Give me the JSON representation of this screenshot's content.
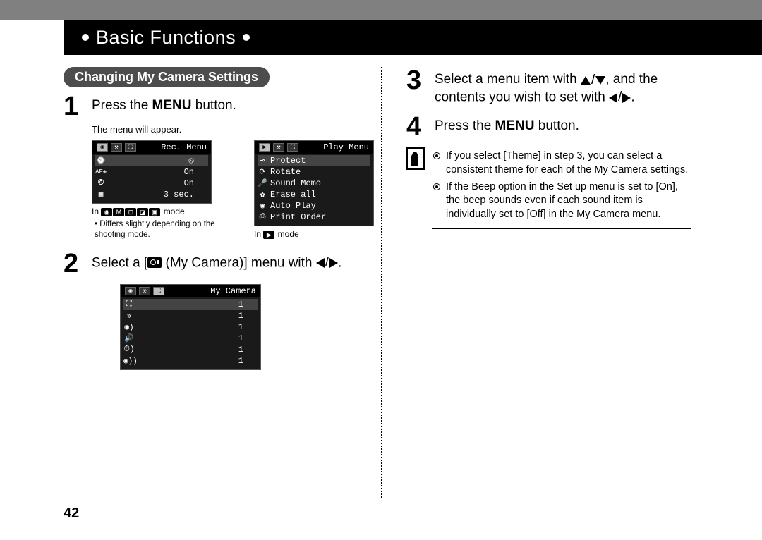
{
  "header_title": "Basic Functions",
  "page_number": "42",
  "pill_title": "Changing My Camera Settings",
  "steps": {
    "s1": {
      "num": "1",
      "text_a": "Press the ",
      "bold": "MENU",
      "text_b": " button."
    },
    "s1_sub": "The menu will appear.",
    "s2": {
      "num": "2",
      "text_a": "Select a [",
      "text_b": " (My Camera)] menu with "
    },
    "s3": {
      "num": "3",
      "text_a": "Select a menu item with ",
      "text_b": ", and the contents you wish to set with "
    },
    "s4": {
      "num": "4",
      "text_a": "Press the ",
      "bold": "MENU",
      "text_b": " button."
    }
  },
  "rec_menu": {
    "title": "Rec. Menu",
    "rows": [
      {
        "icon": "⌚",
        "val": "⦸"
      },
      {
        "icon": "AF❋",
        "val": "On"
      },
      {
        "icon": "⦾",
        "val": "On"
      },
      {
        "icon": "▦",
        "val": "3 sec."
      }
    ]
  },
  "play_menu": {
    "title": "Play Menu",
    "rows": [
      {
        "icon": "⊸",
        "label": "Protect"
      },
      {
        "icon": "⟳",
        "label": "Rotate"
      },
      {
        "icon": "🎤",
        "label": "Sound Memo"
      },
      {
        "icon": "✿",
        "label": "Erase all"
      },
      {
        "icon": "◉",
        "label": "Auto Play"
      },
      {
        "icon": "⎙",
        "label": "Print Order"
      }
    ]
  },
  "mycam_menu": {
    "title": "My Camera",
    "rows": [
      {
        "icon": "⛶",
        "val": "1"
      },
      {
        "icon": "✲",
        "val": "1"
      },
      {
        "icon": "◉)",
        "val": "1"
      },
      {
        "icon": "🔊",
        "val": "1"
      },
      {
        "icon": "⏱)",
        "val": "1"
      },
      {
        "icon": "◉))",
        "val": "1"
      }
    ]
  },
  "captions": {
    "rec_prefix": "In ",
    "rec_suffix": " mode",
    "rec_bullet": "Differs slightly depending on the shooting mode.",
    "play_prefix": "In ",
    "play_suffix": " mode"
  },
  "notes": {
    "n1": "If you select [Theme] in step 3, you can select a consistent theme for each of the My Camera settings.",
    "n2": "If the Beep option in the Set up menu is set to [On], the beep sounds even if each sound item is individually set to [Off] in the My Camera menu."
  }
}
